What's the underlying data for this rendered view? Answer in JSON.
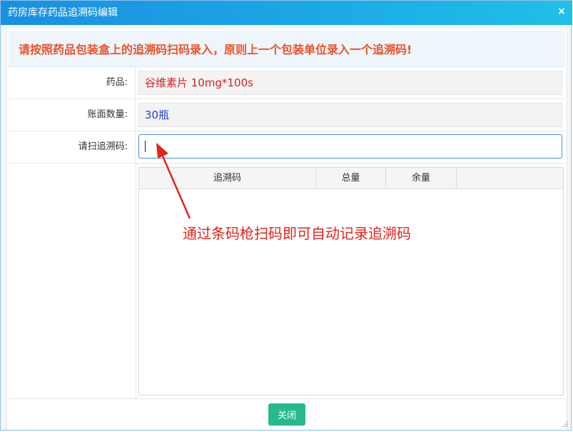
{
  "window": {
    "title": "药房库存药品追溯码编辑",
    "close_glyph": "×"
  },
  "notice": "请按照药品包装盒上的追溯码扫码录入，原则上一个包装单位录入一个追溯码!",
  "form": {
    "drug_label": "药品:",
    "drug_value": "谷维素片 10mg*100s",
    "quantity_label": "账面数量:",
    "quantity_value": "30瓶",
    "scan_label": "请扫追溯码:",
    "scan_value": ""
  },
  "grid": {
    "columns": [
      "追溯码",
      "总量",
      "余量"
    ],
    "rows": []
  },
  "footer": {
    "close_label": "关闭"
  },
  "annotation": {
    "text": "通过条码枪扫码即可自动记录追溯码",
    "color": "#e2231a"
  },
  "colors": {
    "titlebar_start": "#1a8fe0",
    "titlebar_end": "#20c0e8",
    "notice_text": "#e8522b",
    "drug_value": "#d61f1f",
    "quantity_value": "#1d3fd0",
    "close_button": "#26b88f"
  }
}
